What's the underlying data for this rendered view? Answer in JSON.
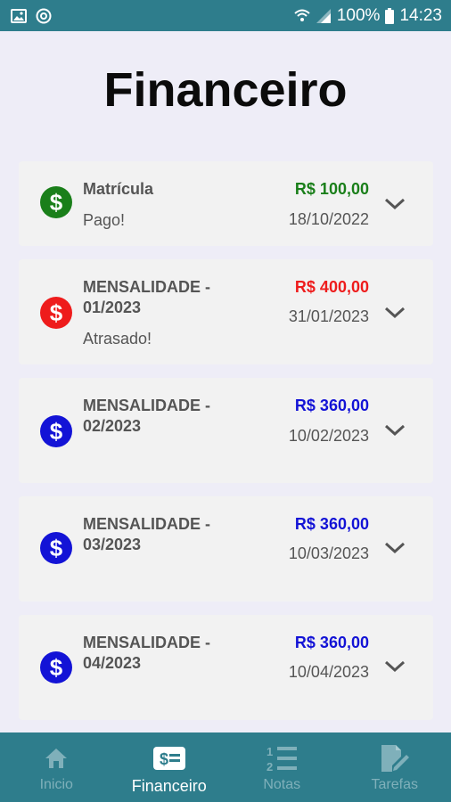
{
  "status_bar": {
    "battery": "100%",
    "time": "14:23"
  },
  "page": {
    "title": "Financeiro"
  },
  "colors": {
    "paid": "#1a7f1a",
    "overdue": "#ee1c1c",
    "pending": "#1313d6",
    "bar": "#2e7d8c"
  },
  "items": [
    {
      "title": "Matrícula",
      "status": "Pago!",
      "amount": "R$ 100,00",
      "date": "18/10/2022"
    },
    {
      "title": "MENSALIDADE - 01/2023",
      "status": "Atrasado!",
      "amount": "R$ 400,00",
      "date": "31/01/2023"
    },
    {
      "title": "MENSALIDADE - 02/2023",
      "status": "",
      "amount": "R$ 360,00",
      "date": "10/02/2023"
    },
    {
      "title": "MENSALIDADE - 03/2023",
      "status": "",
      "amount": "R$ 360,00",
      "date": "10/03/2023"
    },
    {
      "title": "MENSALIDADE - 04/2023",
      "status": "",
      "amount": "R$ 360,00",
      "date": "10/04/2023"
    }
  ],
  "nav": [
    {
      "label": "Inicio",
      "icon": "home-icon"
    },
    {
      "label": "Financeiro",
      "icon": "money-card-icon"
    },
    {
      "label": "Notas",
      "icon": "numbered-list-icon"
    },
    {
      "label": "Tarefas",
      "icon": "edit-document-icon"
    }
  ]
}
